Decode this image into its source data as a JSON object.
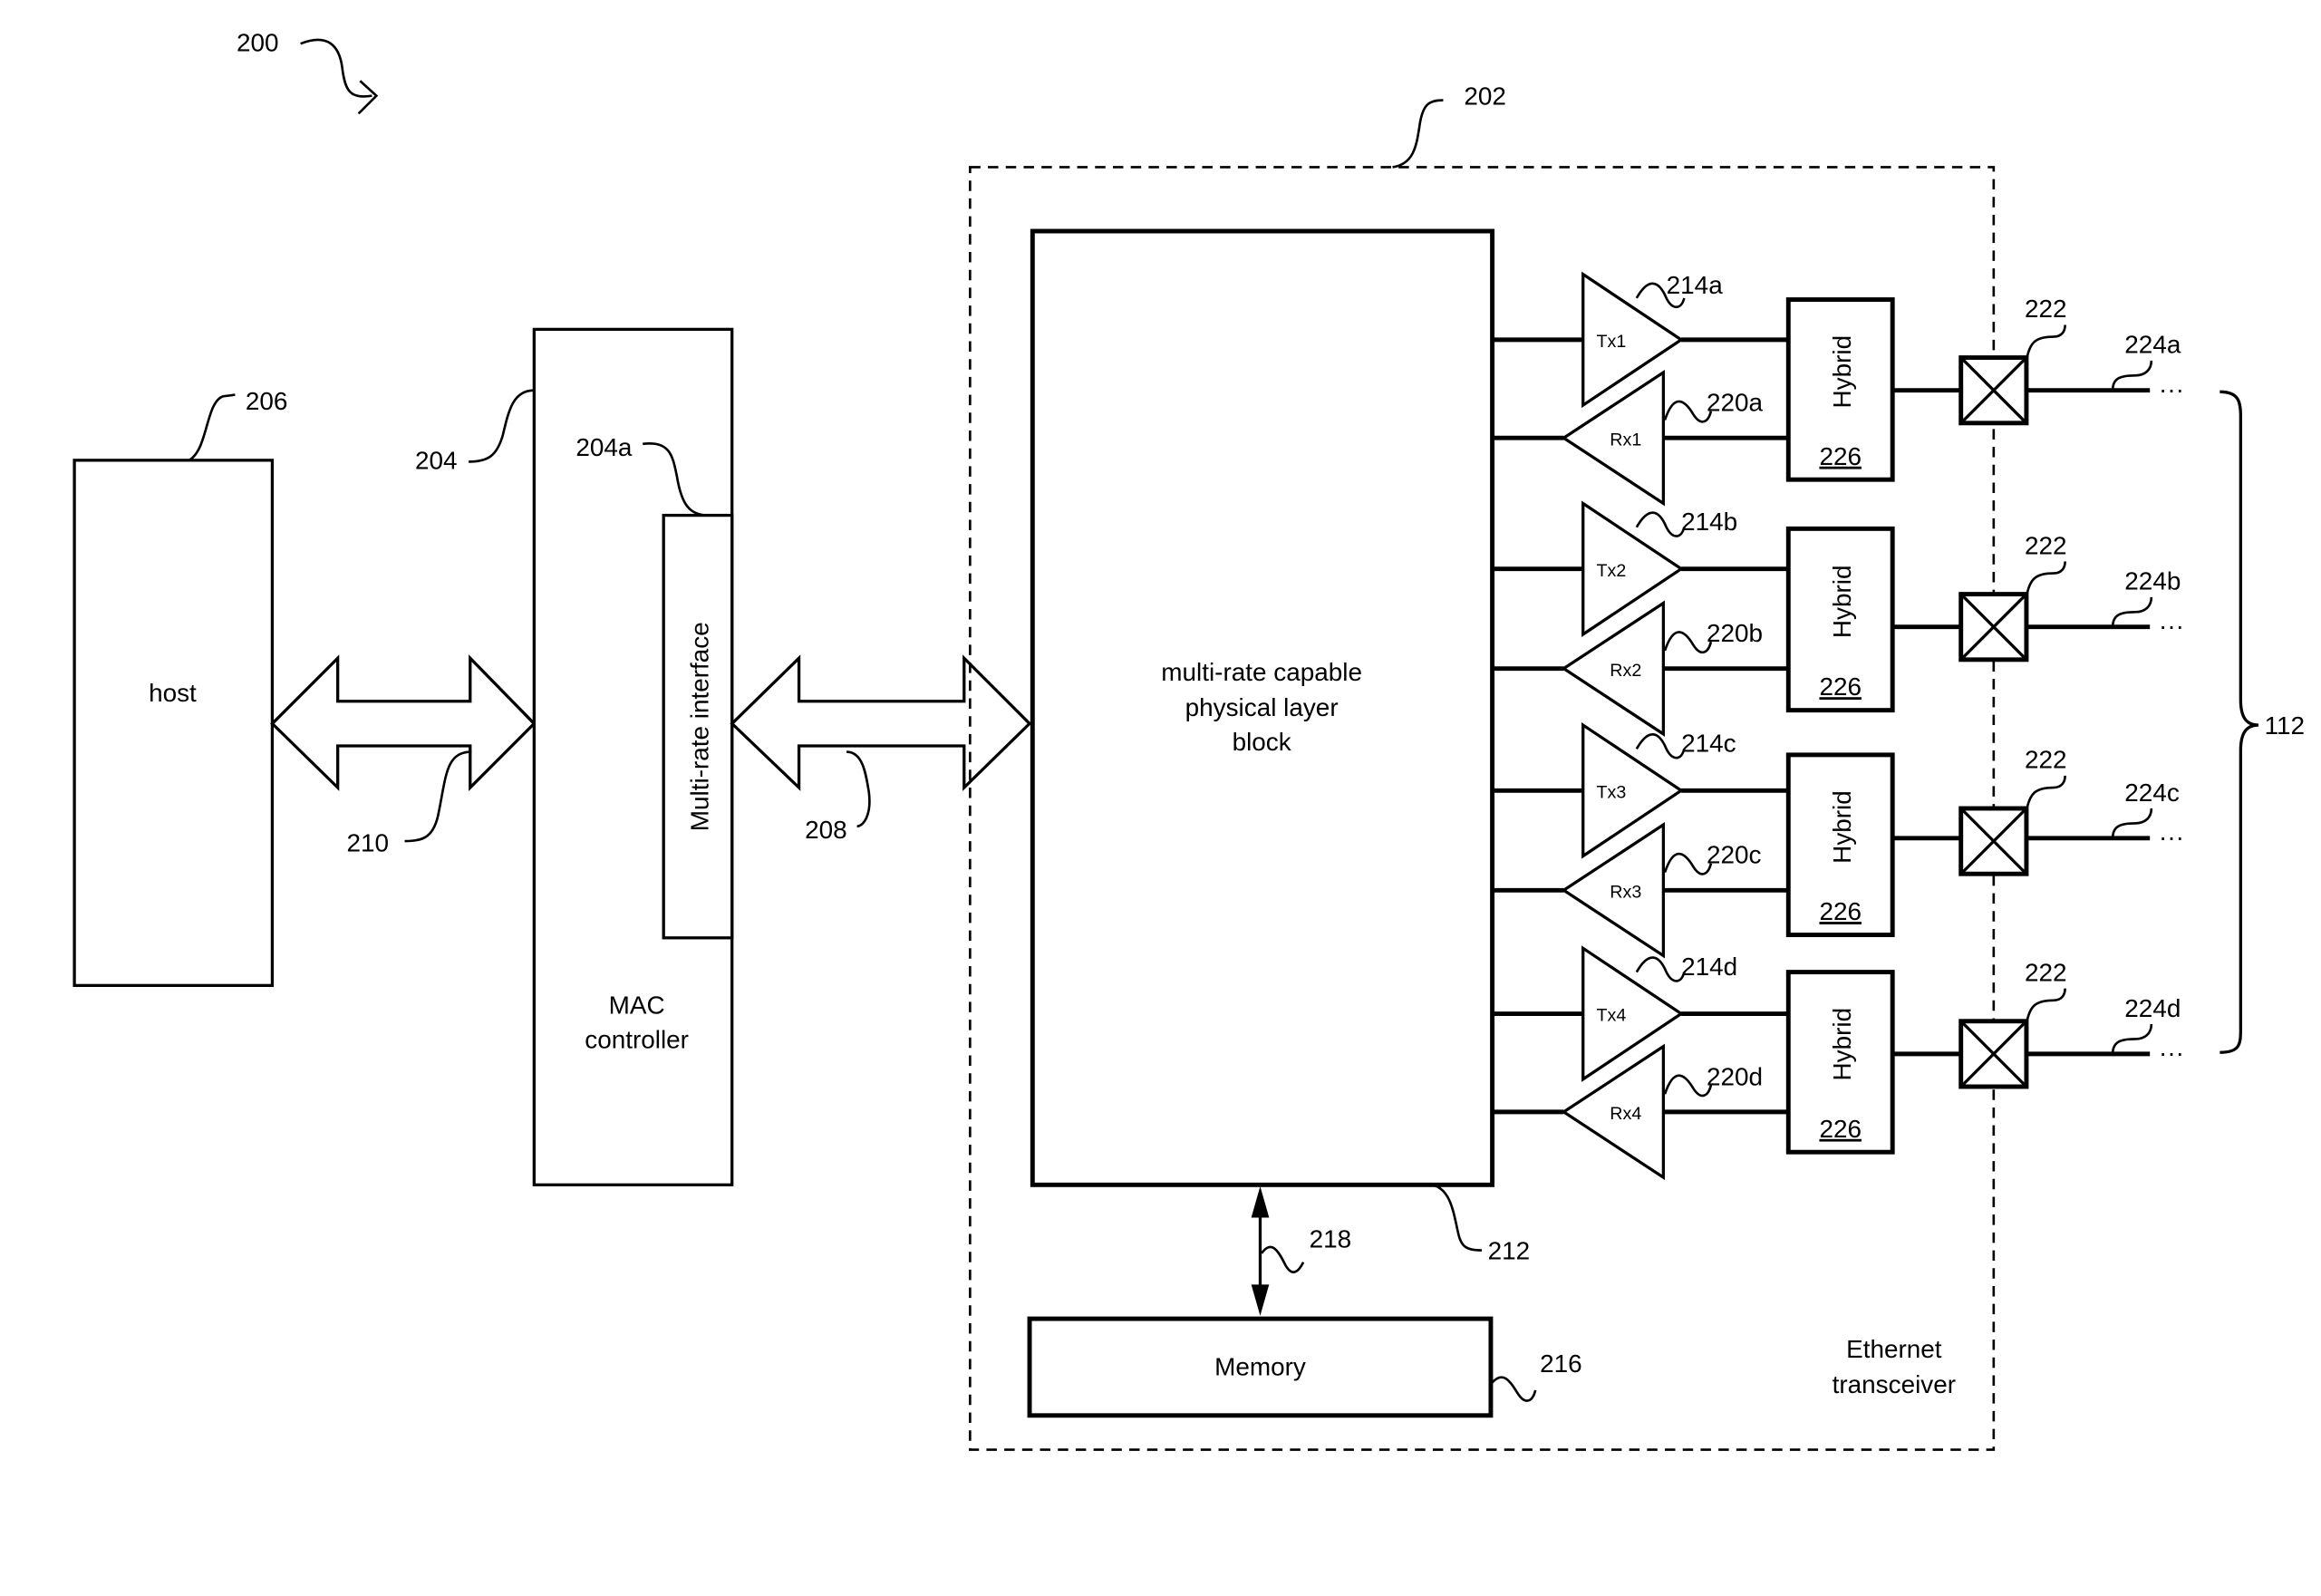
{
  "figure": {
    "ref": "200",
    "host": {
      "label": "host",
      "ref": "206"
    },
    "mac": {
      "label_line1": "MAC",
      "label_line2": "controller",
      "ref": "204",
      "interface": {
        "label": "Multi-rate interface",
        "ref": "204a"
      }
    },
    "bus_host_mac": {
      "ref": "210"
    },
    "bus_mac_phy": {
      "ref": "208"
    },
    "transceiver": {
      "ref": "202",
      "label_line1": "Ethernet",
      "label_line2": "transceiver"
    },
    "phy": {
      "label_line1": "multi-rate capable",
      "label_line2": "physical layer",
      "label_line3": "block",
      "ref": "212"
    },
    "memory": {
      "label": "Memory",
      "ref": "216"
    },
    "memory_link": {
      "ref": "218"
    },
    "channels": [
      {
        "tx": "Tx1",
        "tx_ref": "214a",
        "rx": "Rx1",
        "rx_ref": "220a",
        "hybrid": "Hybrid",
        "hybrid_ref": "226",
        "magnetics_ref": "222",
        "link_ref": "224a",
        "ellipsis": "···"
      },
      {
        "tx": "Tx2",
        "tx_ref": "214b",
        "rx": "Rx2",
        "rx_ref": "220b",
        "hybrid": "Hybrid",
        "hybrid_ref": "226",
        "magnetics_ref": "222",
        "link_ref": "224b",
        "ellipsis": "···"
      },
      {
        "tx": "Tx3",
        "tx_ref": "214c",
        "rx": "Rx3",
        "rx_ref": "220c",
        "hybrid": "Hybrid",
        "hybrid_ref": "226",
        "magnetics_ref": "222",
        "link_ref": "224c",
        "ellipsis": "···"
      },
      {
        "tx": "Tx4",
        "tx_ref": "214d",
        "rx": "Rx4",
        "rx_ref": "220d",
        "hybrid": "Hybrid",
        "hybrid_ref": "226",
        "magnetics_ref": "222",
        "link_ref": "224d",
        "ellipsis": "···"
      }
    ],
    "cable": {
      "ref": "112"
    }
  }
}
